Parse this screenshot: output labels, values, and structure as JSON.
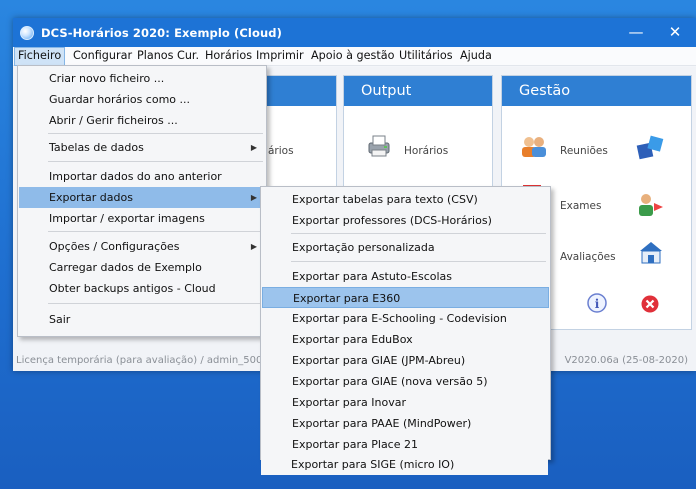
{
  "window": {
    "title": "DCS-Horários 2020: Exemplo (Cloud)",
    "minimize": "—",
    "close": "✕"
  },
  "menubar": [
    "Ficheiro",
    "Configurar",
    "Planos Cur.",
    "Horários",
    "Imprimir",
    "Apoio à gestão",
    "Utilitários",
    "Ajuda"
  ],
  "panels": {
    "left_partial_label": "ários",
    "output": {
      "title": "Output",
      "items": [
        "Horários"
      ]
    },
    "gestao": {
      "title": "Gestão",
      "items": [
        "Reuniões",
        "Exames",
        "Avaliações"
      ]
    }
  },
  "status": {
    "left": "Licença temporária (para avaliação) / admin_5000",
    "right": "V2020.06a (25-08-2020)"
  },
  "file_menu": [
    "Criar novo ficheiro ...",
    "Guardar horários como ...",
    "Abrir / Gerir ficheiros ...",
    "Tabelas de dados",
    "Importar dados do ano anterior",
    "Exportar dados",
    "Importar / exportar imagens",
    "Opções / Configurações",
    "Carregar dados de Exemplo",
    "Obter backups antigos - Cloud",
    "Sair"
  ],
  "export_menu": [
    "Exportar tabelas para texto (CSV)",
    "Exportar professores (DCS-Horários)",
    "Exportação personalizada",
    "Exportar para Astuto-Escolas",
    "Exportar para E360",
    "Exportar para E-Schooling - Codevision",
    "Exportar para EduBox",
    "Exportar para GIAE (JPM-Abreu)",
    "Exportar para GIAE (nova versão 5)",
    "Exportar para Inovar",
    "Exportar para PAAE (MindPower)",
    "Exportar para Place 21",
    "Exportar para SIGE (micro IO)"
  ],
  "colors": {
    "titlebar": "#1d73d6",
    "panel_header": "#2f7fd3",
    "menu_highlight": "#8fbbe9"
  }
}
